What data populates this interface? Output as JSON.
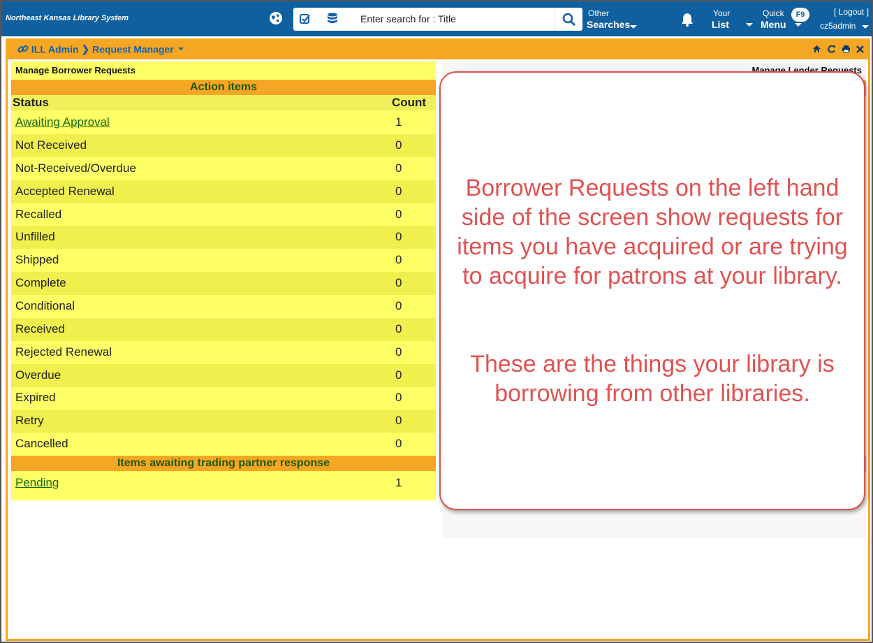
{
  "header": {
    "brand": "Northeast Kansas Library System",
    "search_placeholder": "Enter search for : Title",
    "other_top": "Other",
    "other_bottom": "Searches",
    "your_top": "Your",
    "your_bottom": "List",
    "quick_top": "Quick",
    "quick_bottom": "Menu",
    "f9_badge": "F9",
    "logout": "[ Logout ]",
    "username": "cz5admin"
  },
  "panel": {
    "crumb_root": "ILL Admin",
    "crumb_current": "Request Manager"
  },
  "borrower": {
    "title": "Manage Borrower Requests",
    "section_action": "Action items",
    "col_status": "Status",
    "col_count": "Count",
    "rows": [
      {
        "label": "Awaiting Approval",
        "count": "1"
      },
      {
        "label": "Not Received",
        "count": "0"
      },
      {
        "label": "Not-Received/Overdue",
        "count": "0"
      },
      {
        "label": "Accepted Renewal",
        "count": "0"
      },
      {
        "label": "Recalled",
        "count": "0"
      },
      {
        "label": "Unfilled",
        "count": "0"
      },
      {
        "label": "Shipped",
        "count": "0"
      },
      {
        "label": "Complete",
        "count": "0"
      },
      {
        "label": "Conditional",
        "count": "0"
      },
      {
        "label": "Received",
        "count": "0"
      },
      {
        "label": "Rejected Renewal",
        "count": "0"
      },
      {
        "label": "Overdue",
        "count": "0"
      },
      {
        "label": "Expired",
        "count": "0"
      },
      {
        "label": "Retry",
        "count": "0"
      },
      {
        "label": "Cancelled",
        "count": "0"
      }
    ],
    "section_pending": "Items awaiting trading partner response",
    "pending": {
      "label": "Pending",
      "count": "1"
    }
  },
  "lender": {
    "title": "Manage Lender Requests"
  },
  "callout": {
    "paragraph1": "Borrower Requests on the left hand side of the screen show requests for items you have acquired or are trying to acquire for patrons at your library.",
    "paragraph2": "These are the things your library is borrowing from other libraries."
  },
  "colors": {
    "header_blue": "#10609f",
    "panel_orange": "#f5a623",
    "table_yellow": "#ffff66",
    "link_green": "#1c6a12",
    "callout_red": "#e05252"
  }
}
